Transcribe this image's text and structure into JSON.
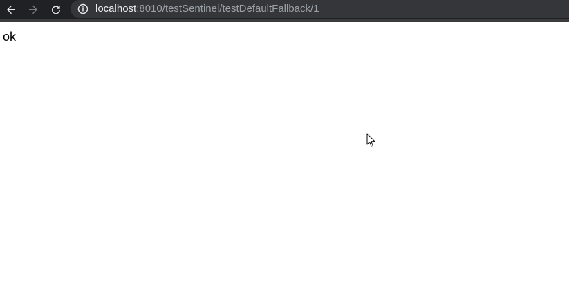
{
  "browser": {
    "url_host": "localhost",
    "url_rest": ":8010/testSentinel/testDefaultFallback/1",
    "icons": {
      "back": "arrow-left-icon",
      "forward": "arrow-right-icon",
      "reload": "reload-icon",
      "site_info": "info-icon"
    },
    "colors": {
      "toolbar": "#202124",
      "omnibox": "#35363a",
      "url_host": "#e8eaed",
      "url_rest": "#9aa0a6"
    }
  },
  "page": {
    "body_text": "ok"
  }
}
